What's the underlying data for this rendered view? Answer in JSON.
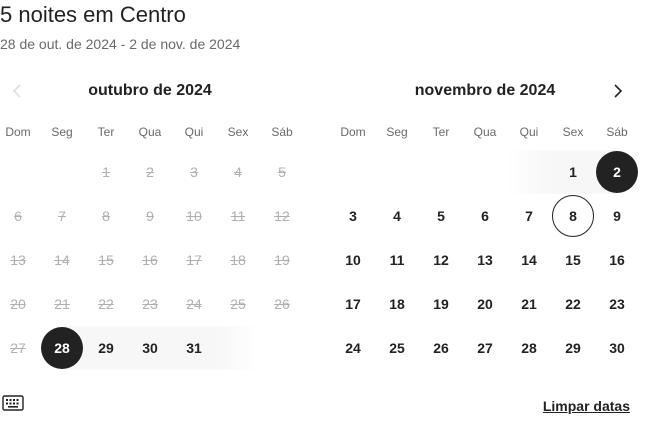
{
  "header": {
    "title": "5 noites em Centro",
    "subtitle": "28 de out. de 2024 - 2 de nov. de 2024"
  },
  "weekdays": [
    "Dom",
    "Seg",
    "Ter",
    "Qua",
    "Qui",
    "Sex",
    "Sáb"
  ],
  "months": [
    {
      "label": "outubro de 2024",
      "first_weekday": 2,
      "days": 31,
      "blocked_through": 27,
      "selected": [
        28
      ],
      "range_days": [
        28,
        29,
        30,
        31
      ],
      "today": null
    },
    {
      "label": "novembro de 2024",
      "first_weekday": 5,
      "days": 30,
      "blocked_through": 0,
      "selected": [
        2
      ],
      "range_days": [
        1,
        2
      ],
      "today": 8
    }
  ],
  "footer": {
    "clear_label": "Limpar datas"
  },
  "icons": {
    "prev": "chevron-left-icon",
    "next": "chevron-right-icon",
    "keyboard": "keyboard-icon"
  },
  "colors": {
    "text": "#222222",
    "muted": "#6a6a6a",
    "disabled": "#b0b0b0",
    "selected_bg": "#222222",
    "range_bg": "#f7f7f7"
  }
}
